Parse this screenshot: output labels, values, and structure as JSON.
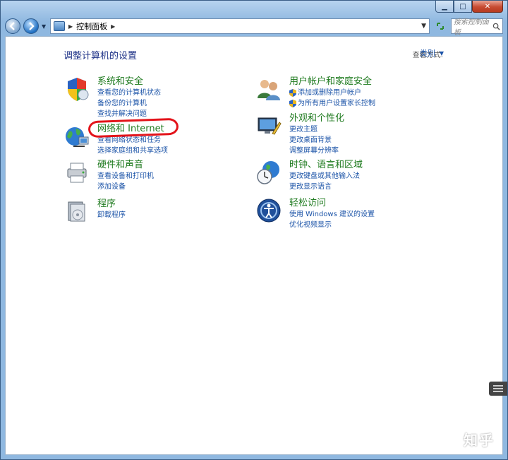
{
  "window": {
    "caption": {
      "minimize": "▁",
      "maximize": "□",
      "close": "✕"
    }
  },
  "address": {
    "breadcrumb": "控制面板"
  },
  "search": {
    "placeholder": "搜索控制面板"
  },
  "page": {
    "title": "调整计算机的设置"
  },
  "view": {
    "label": "查看方式:",
    "selected": "类别"
  },
  "categories": [
    {
      "title": "系统和安全",
      "links": [
        "查看您的计算机状态",
        "备份您的计算机",
        "查找并解决问题"
      ]
    },
    {
      "title": "网络和 Internet",
      "links": [
        "查看网络状态和任务",
        "选择家庭组和共享选项"
      ]
    },
    {
      "title": "硬件和声音",
      "links": [
        "查看设备和打印机",
        "添加设备"
      ]
    },
    {
      "title": "程序",
      "links": [
        "卸载程序"
      ]
    },
    {
      "title": "用户帐户和家庭安全",
      "links": [
        "添加或删除用户帐户",
        "为所有用户设置家长控制"
      ]
    },
    {
      "title": "外观和个性化",
      "links": [
        "更改主题",
        "更改桌面背景",
        "调整屏幕分辨率"
      ]
    },
    {
      "title": "时钟、语言和区域",
      "links": [
        "更改键盘或其他输入法",
        "更改显示语言"
      ]
    },
    {
      "title": "轻松访问",
      "links": [
        "使用 Windows 建议的设置",
        "优化视频显示"
      ]
    }
  ],
  "watermark": "知乎"
}
